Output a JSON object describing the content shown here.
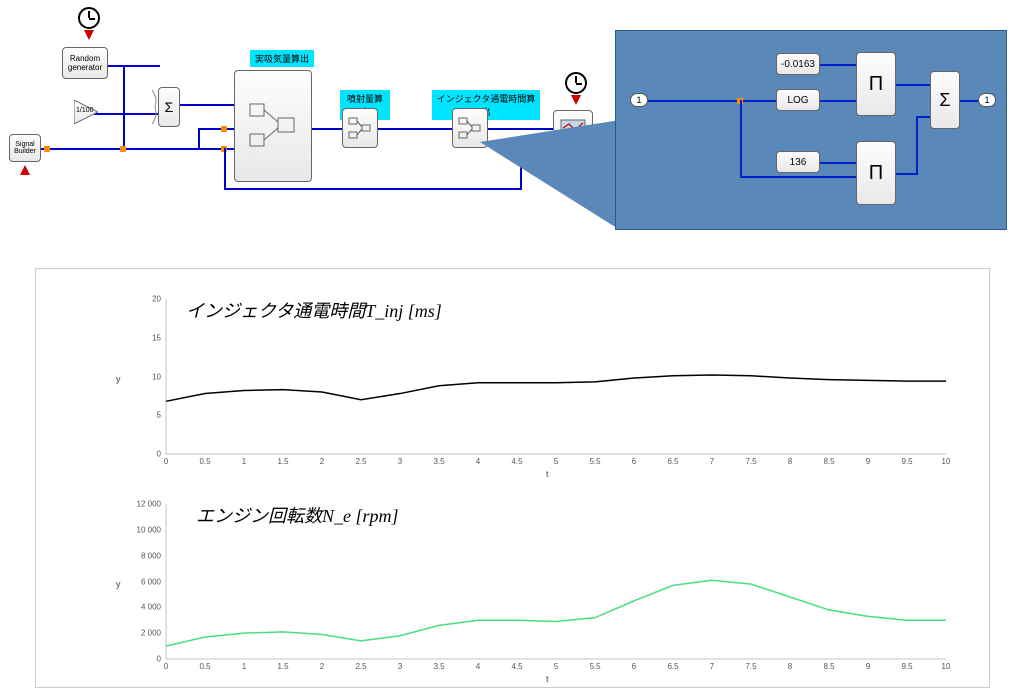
{
  "diagram": {
    "random_gen": "Random\ngenerator",
    "gain": "1/100",
    "sum": "Σ",
    "signal_builder": "Signal\nBuilder",
    "block1_label": "実吸気量算出",
    "block2_label": "噴射量算出",
    "block3_label": "インジェクタ通電時間算出"
  },
  "detail": {
    "port_in": "1",
    "port_out": "1",
    "const1": "-0.0163",
    "log": "LOG",
    "const2": "136",
    "prod": "Π",
    "sum": "Σ"
  },
  "chart_data": [
    {
      "type": "line",
      "title": "インジェクタ通電時間T_inj [ms]",
      "xlabel": "t",
      "ylabel": "y",
      "xlim": [
        0,
        10
      ],
      "ylim": [
        0,
        20
      ],
      "xticks": [
        0,
        0.5,
        1,
        1.5,
        2,
        2.5,
        3,
        3.5,
        4,
        4.5,
        5,
        5.5,
        6,
        6.5,
        7,
        7.5,
        8,
        8.5,
        9,
        9.5,
        10
      ],
      "yticks": [
        0,
        5,
        10,
        15,
        20
      ],
      "series": [
        {
          "name": "Tinj",
          "color": "#000",
          "x": [
            0,
            0.5,
            1,
            1.5,
            2,
            2.5,
            3,
            3.5,
            4,
            4.5,
            5,
            5.5,
            6,
            6.5,
            7,
            7.5,
            8,
            8.5,
            9,
            9.5,
            10
          ],
          "y": [
            6.8,
            7.8,
            8.2,
            8.3,
            8.0,
            7.0,
            7.8,
            8.8,
            9.2,
            9.2,
            9.2,
            9.3,
            9.8,
            10.1,
            10.2,
            10.1,
            9.8,
            9.6,
            9.5,
            9.4,
            9.4
          ]
        }
      ]
    },
    {
      "type": "line",
      "title": "エンジン回転数N_e [rpm]",
      "xlabel": "t",
      "ylabel": "y",
      "xlim": [
        0,
        10
      ],
      "ylim": [
        0,
        12000
      ],
      "xticks": [
        0,
        0.5,
        1,
        1.5,
        2,
        2.5,
        3,
        3.5,
        4,
        4.5,
        5,
        5.5,
        6,
        6.5,
        7,
        7.5,
        8,
        8.5,
        9,
        9.5,
        10
      ],
      "yticks": [
        0,
        2000,
        4000,
        6000,
        8000,
        10000,
        12000
      ],
      "series": [
        {
          "name": "Ne",
          "color": "#4ade80",
          "x": [
            0,
            0.5,
            1,
            1.5,
            2,
            2.5,
            3,
            3.5,
            4,
            4.5,
            5,
            5.5,
            6,
            6.5,
            7,
            7.5,
            8,
            8.5,
            9,
            9.5,
            10
          ],
          "y": [
            1000,
            1700,
            2000,
            2100,
            1900,
            1400,
            1800,
            2600,
            3000,
            3000,
            2900,
            3200,
            4500,
            5700,
            6100,
            5800,
            4800,
            3800,
            3300,
            3000,
            3000
          ]
        }
      ]
    }
  ]
}
